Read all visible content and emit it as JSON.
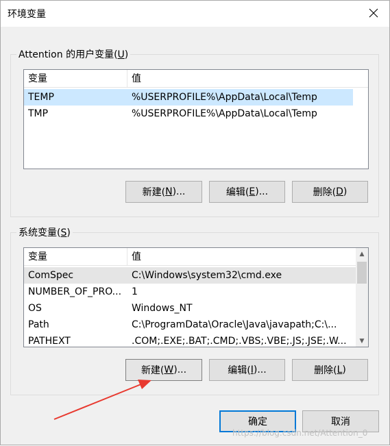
{
  "window": {
    "title": "环境变量",
    "close_glyph": "✕"
  },
  "user_vars": {
    "label_prefix": "Attention 的用户变量(",
    "label_mnemonic": "U",
    "label_suffix": ")",
    "columns": [
      "变量",
      "值"
    ],
    "rows": [
      {
        "name": "TEMP",
        "value": "%USERPROFILE%\\AppData\\Local\\Temp",
        "selected": true
      },
      {
        "name": "TMP",
        "value": "%USERPROFILE%\\AppData\\Local\\Temp",
        "selected": false
      }
    ],
    "buttons": {
      "new": {
        "pre": "新建(",
        "mn": "N",
        "post": ")..."
      },
      "edit": {
        "pre": "编辑(",
        "mn": "E",
        "post": ")..."
      },
      "delete": {
        "pre": "删除(",
        "mn": "D",
        "post": ")"
      }
    }
  },
  "system_vars": {
    "label_prefix": "系统变量(",
    "label_mnemonic": "S",
    "label_suffix": ")",
    "columns": [
      "变量",
      "值"
    ],
    "rows": [
      {
        "name": "ComSpec",
        "value": "C:\\Windows\\system32\\cmd.exe",
        "selected": true
      },
      {
        "name": "NUMBER_OF_PRO...",
        "value": "1",
        "selected": false
      },
      {
        "name": "OS",
        "value": "Windows_NT",
        "selected": false
      },
      {
        "name": "Path",
        "value": "C:\\ProgramData\\Oracle\\Java\\javapath;C:\\...",
        "selected": false
      },
      {
        "name": "PATHEXT",
        "value": ".COM;.EXE;.BAT;.CMD;.VBS;.VBE;.JS;.JSE;.W...",
        "selected": false
      }
    ],
    "buttons": {
      "new": {
        "pre": "新建(",
        "mn": "W",
        "post": ")..."
      },
      "edit": {
        "pre": "编辑(",
        "mn": "I",
        "post": ")..."
      },
      "delete": {
        "pre": "删除(",
        "mn": "L",
        "post": ")"
      }
    },
    "scroll_up_glyph": "▲",
    "scroll_down_glyph": "▼"
  },
  "footer": {
    "ok_label": "确定",
    "cancel_label": "取消"
  },
  "watermark": "https://blog.csdn.net/Attention_0",
  "colors": {
    "selection": "#cce8ff",
    "annotation_arrow": "#e8392f",
    "default_button_border": "#0078d7"
  }
}
